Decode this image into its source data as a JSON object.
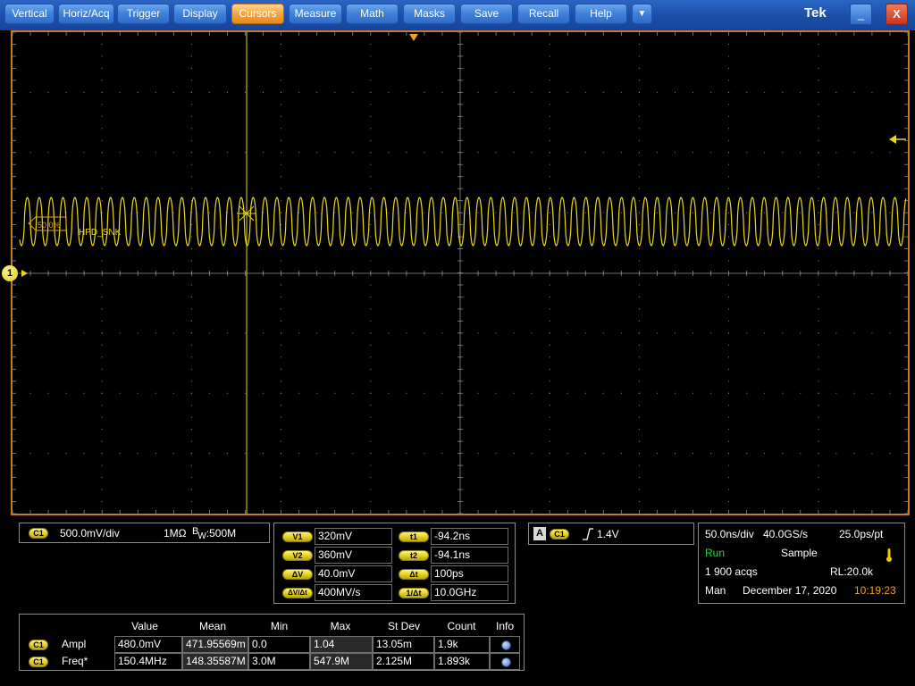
{
  "menu": {
    "items": [
      "Vertical",
      "Horiz/Acq",
      "Trigger",
      "Display",
      "Cursors",
      "Measure",
      "Math",
      "Masks",
      "Save",
      "Recall",
      "Help"
    ],
    "active": "Cursors",
    "dropdown_glyph": "▼",
    "brand": "Tek",
    "minimize_glyph": "_",
    "close_glyph": "X"
  },
  "display": {
    "channel_marker": "1",
    "ref_label": "50.0%",
    "signal_label": "HPD_SNK",
    "trace_color": "#e8d820",
    "cursor_color": "#e8d820",
    "grid_color": "#8a8a8a",
    "frame_color": "#c27a2a"
  },
  "channel_panel": {
    "badge": "C1",
    "scale": "500.0mV/div",
    "impedance": "1MΩ",
    "bw_b": "B",
    "bw_w": "W",
    "bandwidth": ":500M"
  },
  "cursor_panel": {
    "v1_label": "V1",
    "v1": "320mV",
    "v2_label": "V2",
    "v2": "360mV",
    "dv_label": "ΔV",
    "dv": "40.0mV",
    "dvdt_label": "ΔV/Δt",
    "dvdt": "400MV/s",
    "t1_label": "t1",
    "t1": "-94.2ns",
    "t2_label": "t2",
    "t2": "-94.1ns",
    "dt_label": "Δt",
    "dt": "100ps",
    "inv_dt_label": "1/Δt",
    "inv_dt": "10.0GHz"
  },
  "trigger_panel": {
    "mode": "A",
    "badge": "C1",
    "level": "1.4V"
  },
  "horizontal_panel": {
    "scale": "50.0ns/div",
    "sample_rate": "40.0GS/s",
    "resolution": "25.0ps/pt",
    "state": "Run",
    "acq_mode": "Sample",
    "acqs": "1 900 acqs",
    "record_length": "RL:20.0k",
    "mode": "Man",
    "date": "December 17, 2020",
    "time": "10:19:23"
  },
  "measurements": {
    "headers": [
      "Value",
      "Mean",
      "Min",
      "Max",
      "St Dev",
      "Count",
      "Info"
    ],
    "rows": [
      {
        "badge": "C1",
        "name": "Ampl",
        "value": "480.0mV",
        "mean": "471.95569m",
        "min": "0.0",
        "max": "1.04",
        "stdev": "13.05m",
        "count": "1.9k"
      },
      {
        "badge": "C1",
        "name": "Freq*",
        "value": "150.4MHz",
        "mean": "148.35587M",
        "min": "3.0M",
        "max": "547.9M",
        "stdev": "2.125M",
        "count": "1.893k"
      }
    ]
  }
}
